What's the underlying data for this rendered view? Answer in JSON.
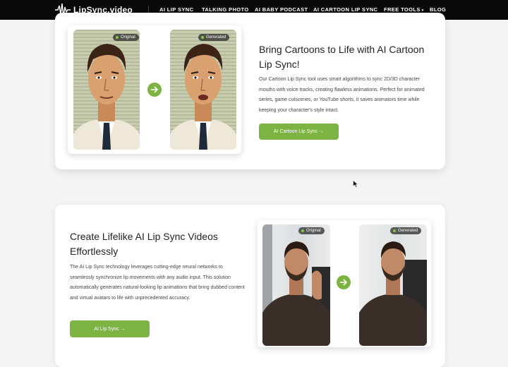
{
  "brand": {
    "name": "LipSync.video"
  },
  "nav": {
    "items": [
      {
        "label": "AI LIP SYNC"
      },
      {
        "label": "TALKING PHOTO"
      },
      {
        "label": "AI BABY PODCAST"
      },
      {
        "label": "AI CARTOON LIP SYNC"
      },
      {
        "label": "FREE TOOLS"
      },
      {
        "label": "BLOG"
      }
    ]
  },
  "section1": {
    "title": "Bring Cartoons to Life with AI Cartoon Lip Sync!",
    "description": "Our Cartoon Lip Sync tool uses smart algorithms to sync 2D/3D character mouths with voice tracks, creating flawless animations. Perfect for animated series, game cutscenes, or YouTube shorts, it saves animators time while keeping your character's style intact.",
    "cta": "AI Cartoon Lip Sync →",
    "badge_original": "Original",
    "badge_generated": "Generated"
  },
  "section2": {
    "title": "Create Lifelike AI Lip Sync Videos Effortlessly",
    "description": "The AI Lip Sync technology leverages cutting-edge neural networks to seamlessly synchronize lip movements with any audio input. This solution automatically generates natural-looking lip animations that bring dubbed content and virtual avatars to life with unprecedented accuracy.",
    "cta": "AI Lip Sync →",
    "badge_original": "Original",
    "badge_generated": "Generated"
  },
  "colors": {
    "accent": "#7cb342",
    "nav_bg": "#0a0a0a"
  }
}
